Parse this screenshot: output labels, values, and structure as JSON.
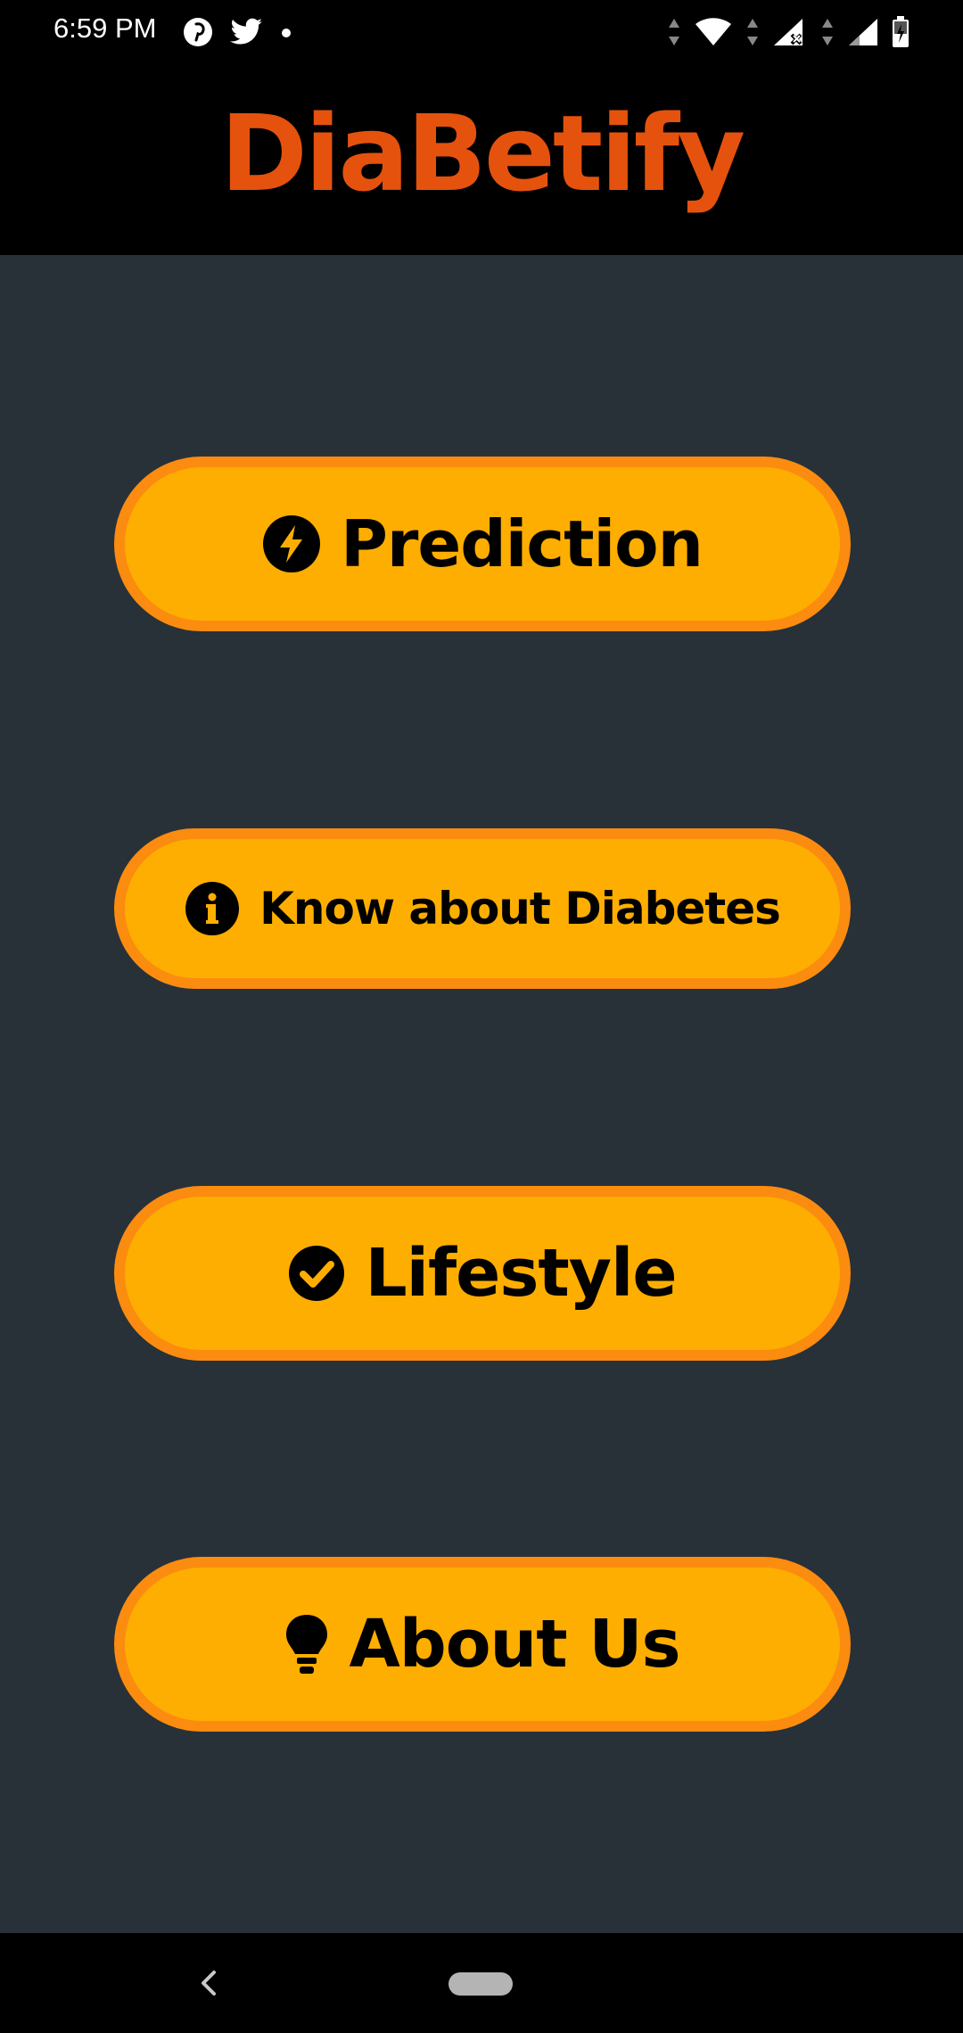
{
  "status_bar": {
    "time": "6:59 PM",
    "left_icons": [
      "pinterest-icon",
      "twitter-icon",
      "notification-dot-icon"
    ],
    "right_icons": [
      "data-arrows-icon",
      "wifi-icon",
      "signal-no-service-icon",
      "signal-icon",
      "battery-charging-icon"
    ]
  },
  "header": {
    "title": "DiaBetify"
  },
  "menu": {
    "items": [
      {
        "label": "Prediction",
        "icon": "bolt-icon"
      },
      {
        "label": "Know about Diabetes",
        "icon": "info-icon"
      },
      {
        "label": "Lifestyle",
        "icon": "check-circle-icon"
      },
      {
        "label": "About Us",
        "icon": "lightbulb-icon"
      }
    ]
  },
  "navigation_bar": {
    "buttons": [
      "back-icon",
      "home-pill"
    ]
  },
  "colors": {
    "brand_title": "#e5520d",
    "button_fill": "#feae00",
    "button_border": "#fb8c10",
    "background": "#283138",
    "bars": "#000000"
  }
}
